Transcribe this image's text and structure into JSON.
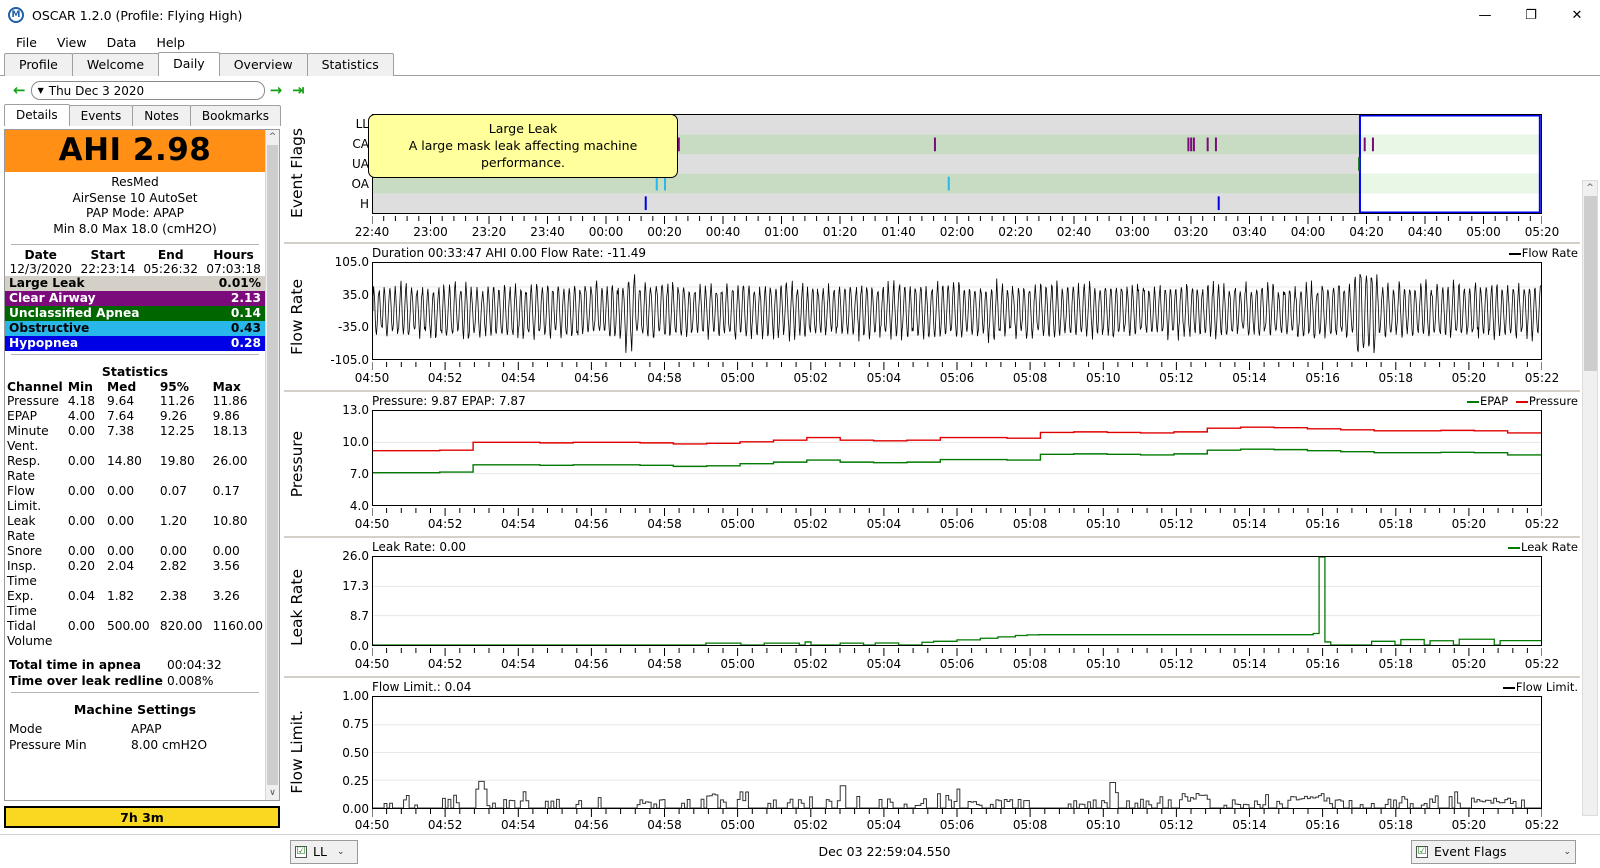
{
  "window": {
    "title": "OSCAR 1.2.0 (Profile: Flying High)",
    "icon": "oscar-logo-icon",
    "minimize": "—",
    "maximize": "❐",
    "close": "✕"
  },
  "menubar": {
    "items": [
      "File",
      "View",
      "Data",
      "Help"
    ]
  },
  "tabs": {
    "items": [
      "Profile",
      "Welcome",
      "Daily",
      "Overview",
      "Statistics"
    ],
    "active": "Daily"
  },
  "datenav": {
    "prev_icon": "←",
    "next_icon": "→",
    "end_icon": "⇥",
    "caret": "▼",
    "value": "Thu Dec 3 2020"
  },
  "left": {
    "subtabs": {
      "items": [
        "Details",
        "Events",
        "Notes",
        "Bookmarks"
      ],
      "active": "Details"
    },
    "ahi": "AHI 2.98",
    "ahi_color": "#ff9015",
    "machine": [
      "ResMed",
      "AirSense 10 AutoSet",
      "PAP Mode: APAP",
      "Min 8.0 Max 18.0 (cmH2O)"
    ],
    "session": {
      "headers": [
        "Date",
        "Start",
        "End",
        "Hours"
      ],
      "values": [
        "12/3/2020",
        "22:23:14",
        "05:26:32",
        "07:03:18"
      ]
    },
    "events": [
      {
        "label": "Large Leak",
        "value": "0.01%",
        "bg": "#d4d0c8",
        "fg": "#000000"
      },
      {
        "label": "Clear Airway",
        "value": "2.13",
        "bg": "#7b0a7b",
        "fg": "#ffffff"
      },
      {
        "label": "Unclassified Apnea",
        "value": "0.14",
        "bg": "#006600",
        "fg": "#ffffff"
      },
      {
        "label": "Obstructive",
        "value": "0.43",
        "bg": "#29b6e8",
        "fg": "#000000"
      },
      {
        "label": "Hypopnea",
        "value": "0.28",
        "bg": "#0000e6",
        "fg": "#ffffff"
      }
    ],
    "stats_title": "Statistics",
    "stats_headers": [
      "Channel",
      "Min",
      "Med",
      "95%",
      "Max"
    ],
    "stats_rows": [
      {
        "channel": "Pressure",
        "min": "4.18",
        "med": "9.64",
        "p95": "11.26",
        "max": "11.86"
      },
      {
        "channel": "EPAP",
        "min": "4.00",
        "med": "7.64",
        "p95": "9.26",
        "max": "9.86"
      },
      {
        "channel": "Minute Vent.",
        "min": "0.00",
        "med": "7.38",
        "p95": "12.25",
        "max": "18.13"
      },
      {
        "channel": "Resp. Rate",
        "min": "0.00",
        "med": "14.80",
        "p95": "19.80",
        "max": "26.00"
      },
      {
        "channel": "Flow Limit.",
        "min": "0.00",
        "med": "0.00",
        "p95": "0.07",
        "max": "0.17"
      },
      {
        "channel": "Leak Rate",
        "min": "0.00",
        "med": "0.00",
        "p95": "1.20",
        "max": "10.80"
      },
      {
        "channel": "Snore",
        "min": "0.00",
        "med": "0.00",
        "p95": "0.00",
        "max": "0.00"
      },
      {
        "channel": "Insp. Time",
        "min": "0.20",
        "med": "2.04",
        "p95": "2.82",
        "max": "3.56"
      },
      {
        "channel": "Exp. Time",
        "min": "0.04",
        "med": "1.82",
        "p95": "2.38",
        "max": "3.26"
      },
      {
        "channel": "Tidal Volume",
        "min": "0.00",
        "med": "500.00",
        "p95": "820.00",
        "max": "1160.00"
      }
    ],
    "totals": [
      {
        "label": "Total time in apnea",
        "value": "00:04:32"
      },
      {
        "label": "Time over leak redline",
        "value": "0.008%"
      }
    ],
    "machine_settings_title": "Machine Settings",
    "machine_settings": [
      {
        "key": "Mode",
        "value": "APAP"
      },
      {
        "key": "Pressure Min",
        "value": "8.00 cmH2O"
      }
    ],
    "hours_button": "7h 3m",
    "hours_button_color": "#f8d820"
  },
  "statusbar": {
    "channel_combo": {
      "checked": "☑",
      "label": "LL",
      "caret": "⌄"
    },
    "timestamp": "Dec 03 22:59:04.550",
    "flags_combo": {
      "checked": "☑",
      "label": "Event Flags",
      "caret": "⌄"
    }
  },
  "tooltip": {
    "title": "Large Leak",
    "body": "A large mask leak affecting machine performance."
  },
  "chart_data": [
    {
      "id": "event-flags",
      "type": "scatter",
      "title": "",
      "ylabel": "Event Flags",
      "legend": [],
      "rows": [
        "LL",
        "CA",
        "UA",
        "OA",
        "H"
      ],
      "row_colors": [
        "#808080",
        "#7b0a7b",
        "#006600",
        "#29b6e8",
        "#0000e6"
      ],
      "xlabel": "",
      "x_ticks": [
        "22:40",
        "23:00",
        "23:20",
        "23:40",
        "00:00",
        "00:20",
        "00:40",
        "01:00",
        "01:20",
        "01:40",
        "02:00",
        "02:20",
        "02:40",
        "03:00",
        "03:20",
        "03:40",
        "04:00",
        "04:20",
        "04:40",
        "05:00",
        "05:20"
      ],
      "xlim": [
        "22:23",
        "05:27"
      ],
      "selection": {
        "from": "04:47",
        "to": "05:27",
        "color": "#0000ff"
      },
      "events": [
        {
          "row": "CA",
          "t": "00:10"
        },
        {
          "row": "CA",
          "t": "00:12"
        },
        {
          "row": "CA",
          "t": "00:14"
        },
        {
          "row": "CA",
          "t": "01:47"
        },
        {
          "row": "CA",
          "t": "03:19"
        },
        {
          "row": "CA",
          "t": "03:20"
        },
        {
          "row": "CA",
          "t": "03:21"
        },
        {
          "row": "CA",
          "t": "03:26"
        },
        {
          "row": "CA",
          "t": "03:29"
        },
        {
          "row": "CA",
          "t": "04:23"
        },
        {
          "row": "CA",
          "t": "04:26"
        },
        {
          "row": "UA",
          "t": "04:21"
        },
        {
          "row": "OA",
          "t": "00:06"
        },
        {
          "row": "OA",
          "t": "00:09"
        },
        {
          "row": "OA",
          "t": "01:52"
        },
        {
          "row": "H",
          "t": "00:02"
        },
        {
          "row": "H",
          "t": "03:30"
        }
      ]
    },
    {
      "id": "flow-rate",
      "type": "line",
      "title": "Duration 00:33:47 AHI 0.00 Flow Rate: -11.49",
      "ylabel": "Flow Rate",
      "legend": [
        {
          "name": "Flow Rate",
          "color": "#000000"
        }
      ],
      "y_ticks": [
        "105.0",
        "35.0",
        "-35.0",
        "-105.0"
      ],
      "ylim": [
        -105,
        105
      ],
      "x_ticks": [
        "04:50",
        "04:52",
        "04:54",
        "04:56",
        "04:58",
        "05:00",
        "05:02",
        "05:04",
        "05:06",
        "05:08",
        "05:10",
        "05:12",
        "05:14",
        "05:16",
        "05:18",
        "05:20",
        "05:22"
      ],
      "xlim": [
        "04:49",
        "05:23"
      ],
      "grid": true
    },
    {
      "id": "pressure",
      "type": "line",
      "title": "Pressure: 9.87 EPAP: 7.87",
      "ylabel": "Pressure",
      "legend": [
        {
          "name": "EPAP",
          "color": "#007a00"
        },
        {
          "name": "Pressure",
          "color": "#e00000"
        }
      ],
      "y_ticks": [
        "13.0",
        "10.0",
        "7.0",
        "4.0"
      ],
      "ylim": [
        4,
        13
      ],
      "x_ticks": [
        "04:50",
        "04:52",
        "04:54",
        "04:56",
        "04:58",
        "05:00",
        "05:02",
        "05:04",
        "05:06",
        "05:08",
        "05:10",
        "05:12",
        "05:14",
        "05:16",
        "05:18",
        "05:20",
        "05:22"
      ],
      "xlim": [
        "04:49",
        "05:23"
      ],
      "series": [
        {
          "name": "Pressure",
          "color": "#e00000",
          "values": [
            9.2,
            9.2,
            9.25,
            10.0,
            10.0,
            9.95,
            10.0,
            10.0,
            9.95,
            9.85,
            9.9,
            10.05,
            10.2,
            10.45,
            10.2,
            10.15,
            10.2,
            10.45,
            10.45,
            10.4,
            10.95,
            11.0,
            10.95,
            10.9,
            11.0,
            11.35,
            11.45,
            11.4,
            11.3,
            11.2,
            11.1,
            11.1,
            11.15,
            11.1,
            10.9
          ]
        },
        {
          "name": "EPAP",
          "color": "#007a00",
          "values": [
            7.1,
            7.1,
            7.15,
            7.85,
            7.85,
            7.8,
            7.85,
            7.85,
            7.8,
            7.7,
            7.75,
            7.95,
            8.1,
            8.3,
            8.1,
            8.05,
            8.1,
            8.35,
            8.35,
            8.3,
            8.85,
            8.9,
            8.85,
            8.8,
            8.9,
            9.25,
            9.35,
            9.3,
            9.2,
            9.1,
            9.0,
            9.0,
            9.05,
            9.0,
            8.8
          ]
        }
      ],
      "grid": true
    },
    {
      "id": "leak-rate",
      "type": "line",
      "title": "Leak Rate: 0.00",
      "ylabel": "Leak Rate",
      "legend": [
        {
          "name": "Leak Rate",
          "color": "#007a00"
        }
      ],
      "y_ticks": [
        "26.0",
        "17.3",
        "8.7",
        "0.0"
      ],
      "ylim": [
        0,
        26
      ],
      "x_ticks": [
        "04:50",
        "04:52",
        "04:54",
        "04:56",
        "04:58",
        "05:00",
        "05:02",
        "05:04",
        "05:06",
        "05:08",
        "05:10",
        "05:12",
        "05:14",
        "05:16",
        "05:18",
        "05:20",
        "05:22"
      ],
      "xlim": [
        "04:49",
        "05:23"
      ],
      "grid": true
    },
    {
      "id": "flow-limit",
      "type": "line",
      "title": "Flow Limit.: 0.04",
      "ylabel": "Flow Limit.",
      "legend": [
        {
          "name": "Flow Limit.",
          "color": "#000000"
        }
      ],
      "y_ticks": [
        "1.00",
        "0.75",
        "0.50",
        "0.25",
        "0.00"
      ],
      "ylim": [
        0,
        1
      ],
      "x_ticks": [
        "04:50",
        "04:52",
        "04:54",
        "04:56",
        "04:58",
        "05:00",
        "05:02",
        "05:04",
        "05:06",
        "05:08",
        "05:10",
        "05:12",
        "05:14",
        "05:16",
        "05:18",
        "05:20",
        "05:22"
      ],
      "xlim": [
        "04:49",
        "05:23"
      ],
      "grid": true
    }
  ]
}
